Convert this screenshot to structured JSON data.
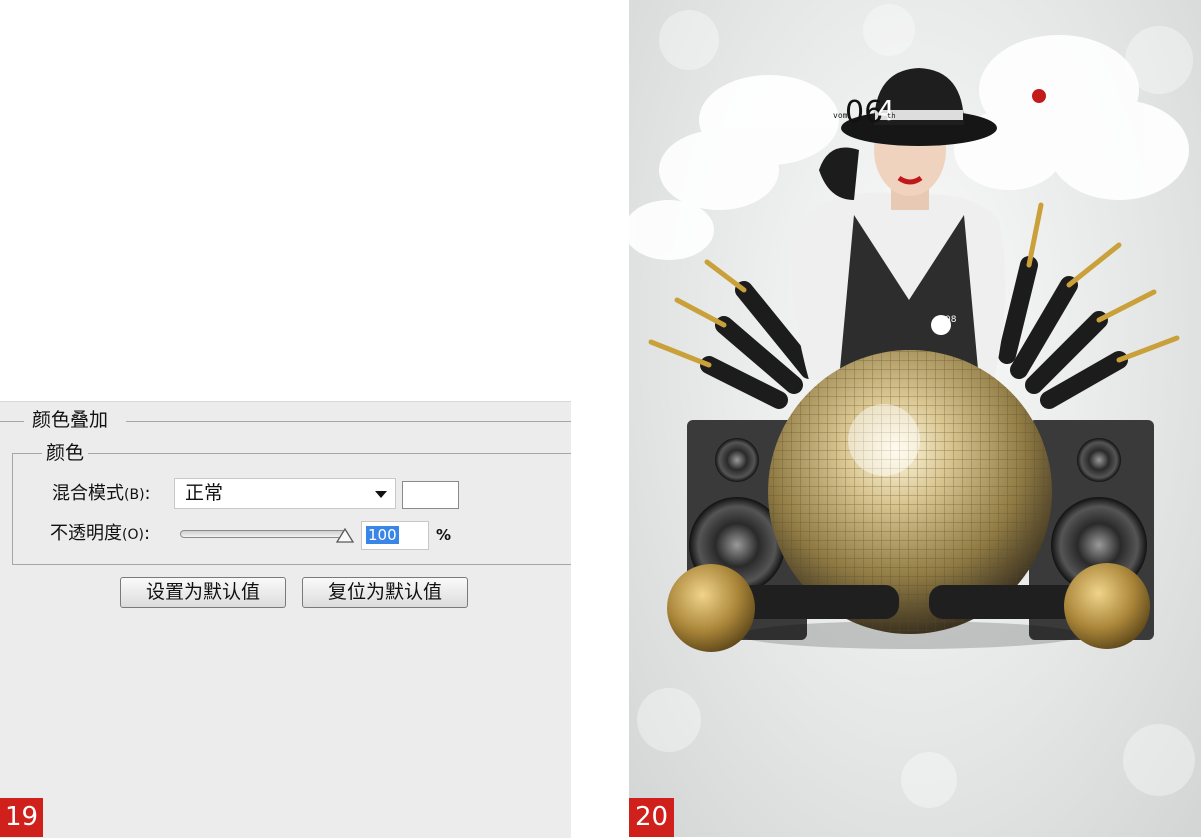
{
  "dialog": {
    "outer_group_title": "颜色叠加",
    "inner_group_title": "颜色",
    "blend_mode": {
      "label": "混合模式",
      "hotkey": "(B)",
      "colon": ":",
      "value": "正常",
      "swatch_color": "#ffffff"
    },
    "opacity": {
      "label": "不透明度",
      "hotkey": "(O)",
      "colon": ":",
      "value": "100",
      "unit": "%",
      "slider_fraction": 1.0
    },
    "buttons": {
      "make_default": "设置为默认值",
      "reset_default": "复位为默认值"
    }
  },
  "figure_labels": {
    "left": "19",
    "right": "20"
  },
  "poster": {
    "big_number_a": "06",
    "big_number_b": "4",
    "small_text_left": "vom",
    "small_text_right": "th",
    "badge_number": "08"
  },
  "colors": {
    "label_red": "#d0201b",
    "selection_blue": "#3a86e6",
    "dialog_bg": "#ececec"
  }
}
